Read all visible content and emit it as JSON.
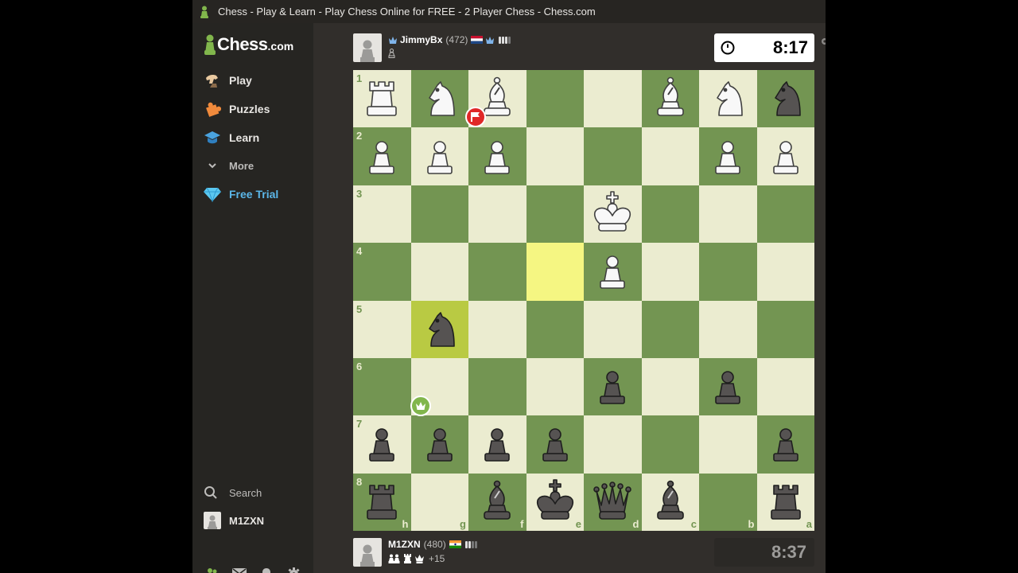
{
  "window": {
    "title": "Chess - Play & Learn - Play Chess Online for FREE - 2 Player Chess - Chess.com"
  },
  "logo": {
    "text": "Chess",
    "suffix": ".com"
  },
  "sidebar": {
    "items": [
      {
        "label": "Play",
        "icon": "play-hand-icon"
      },
      {
        "label": "Puzzles",
        "icon": "puzzle-icon"
      },
      {
        "label": "Learn",
        "icon": "graduation-cap-icon"
      },
      {
        "label": "More",
        "icon": "chevron-down-icon"
      },
      {
        "label": "Free Trial",
        "icon": "diamond-icon"
      }
    ],
    "search_label": "Search",
    "username": "M1ZXN",
    "footer_icons": [
      "friends-icon",
      "mail-icon",
      "bell-icon",
      "gear-icon"
    ]
  },
  "opponent": {
    "name": "JimmyBx",
    "rating": "(472)",
    "clock": "8:17",
    "flag": "Netherlands",
    "connection_bars": 3
  },
  "player": {
    "name": "M1ZXN",
    "rating": "(480)",
    "clock": "8:37",
    "flag": "India",
    "material_advantage": "+15",
    "captured": [
      "pawn",
      "pawn",
      "rook",
      "queen"
    ],
    "connection_bars": 2
  },
  "board": {
    "orientation": "black",
    "ranks_top_to_bottom": [
      "1",
      "2",
      "3",
      "4",
      "5",
      "6",
      "7",
      "8"
    ],
    "files_left_to_right": [
      "h",
      "g",
      "f",
      "e",
      "d",
      "c",
      "b",
      "a"
    ],
    "highlighted": [
      "e4",
      "g5"
    ],
    "badges": {
      "flag_on": "d3",
      "crown_on": "e8"
    },
    "rows": [
      [
        "wR",
        "wN",
        "wB",
        "",
        "",
        "wB",
        "wN",
        "bN"
      ],
      [
        "wP",
        "wP",
        "wP",
        "",
        "",
        "",
        "wP",
        "wP"
      ],
      [
        "",
        "",
        "",
        "",
        "wK",
        "",
        "",
        ""
      ],
      [
        "",
        "",
        "",
        "",
        "wP",
        "",
        "",
        ""
      ],
      [
        "",
        "bN",
        "",
        "",
        "",
        "",
        "",
        ""
      ],
      [
        "",
        "",
        "",
        "",
        "bP",
        "",
        "bP",
        ""
      ],
      [
        "bP",
        "bP",
        "bP",
        "bP",
        "",
        "",
        "",
        "bP"
      ],
      [
        "bR",
        "",
        "bB",
        "bK",
        "bQ",
        "bB",
        "",
        "bR"
      ]
    ]
  },
  "colors": {
    "light_square": "#ebecd0",
    "dark_square": "#739552",
    "highlight": "#f5f682",
    "accent_green": "#81b64c",
    "trial_blue": "#5bb6e8"
  }
}
